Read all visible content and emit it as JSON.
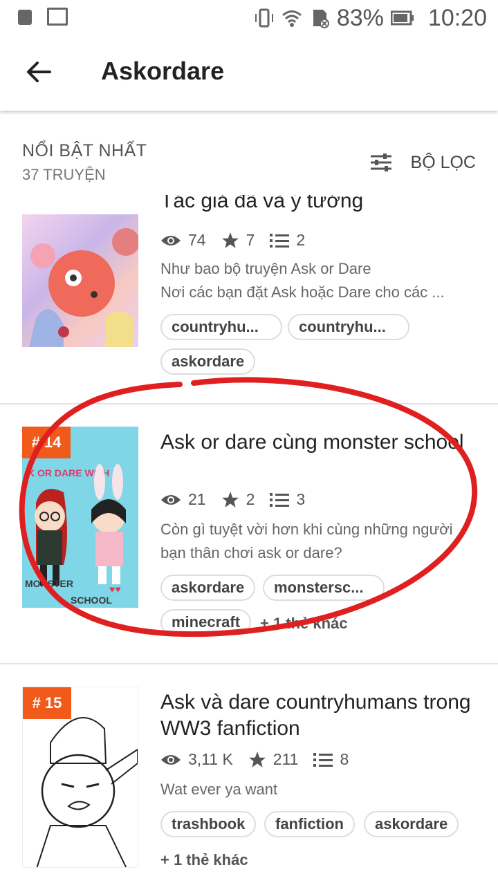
{
  "status": {
    "battery": "83%",
    "time": "10:20"
  },
  "appbar": {
    "title": "Askordare"
  },
  "section": {
    "title": "NỔI BẬT NHẤT",
    "count": "37 TRUYỆN",
    "filter_label": "BỘ LỌC"
  },
  "stories": [
    {
      "title": "Tác giả đã và ý tưởng",
      "views": "74",
      "stars": "7",
      "parts": "2",
      "desc": [
        "Như bao bộ truyện Ask or Dare",
        "Nơi các bạn đặt Ask hoặc Dare cho các ..."
      ],
      "tags": [
        "countryhu...",
        "countryhu...",
        "askordare"
      ]
    },
    {
      "rank": "# 14",
      "title": "Ask or dare cùng monster school",
      "views": "21",
      "stars": "2",
      "parts": "3",
      "desc": [
        "Còn gì tuyệt vời hơn khi cùng những người",
        "bạn thân chơi ask or dare?"
      ],
      "tags": [
        "askordare",
        "monstersc...",
        "minecraft"
      ],
      "more": "+ 1 thẻ khác",
      "cover_text": "ASK OR DARE WITH MONSTER SCHOOL"
    },
    {
      "rank": "# 15",
      "title": "Ask và dare countryhumans trong WW3 fanfiction",
      "views": "3,11 K",
      "stars": "211",
      "parts": "8",
      "desc": [
        "Wat ever ya want"
      ],
      "tags": [
        "trashbook",
        "fanfiction",
        "askordare"
      ],
      "more": "+ 1 thẻ khác"
    }
  ]
}
